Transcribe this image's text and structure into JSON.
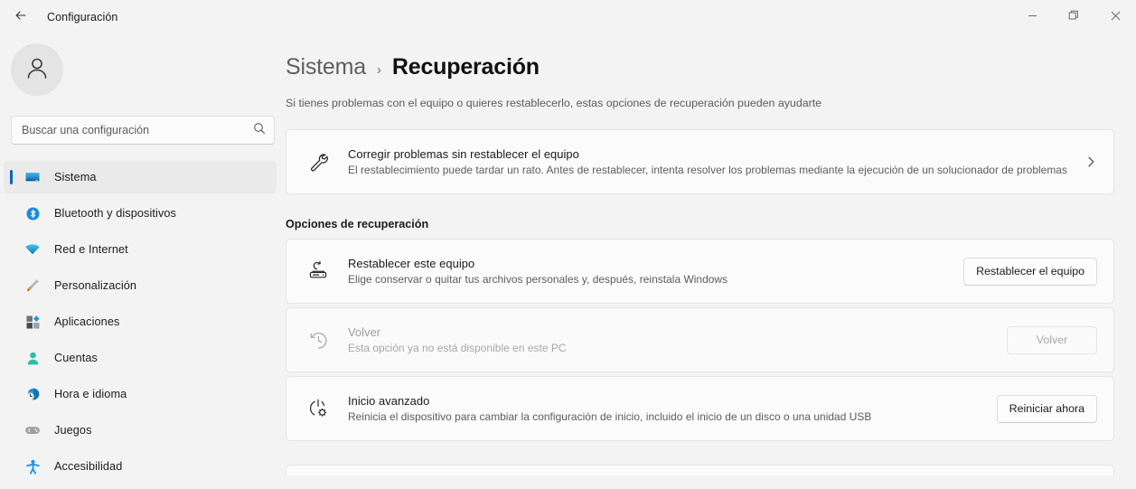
{
  "window": {
    "app_title": "Configuración",
    "back_icon": "back-arrow-icon",
    "minimize_label": "Minimizar",
    "maximize_label": "Maximizar",
    "close_label": "Cerrar"
  },
  "sidebar": {
    "avatar_icon": "user-avatar-icon",
    "search": {
      "placeholder": "Buscar una configuración",
      "value": "",
      "icon": "search-icon"
    },
    "items": [
      {
        "label": "Sistema",
        "icon": "monitor-icon",
        "active": true
      },
      {
        "label": "Bluetooth y dispositivos",
        "icon": "bluetooth-icon",
        "active": false
      },
      {
        "label": "Red e Internet",
        "icon": "wifi-icon",
        "active": false
      },
      {
        "label": "Personalización",
        "icon": "paintbrush-icon",
        "active": false
      },
      {
        "label": "Aplicaciones",
        "icon": "apps-icon",
        "active": false
      },
      {
        "label": "Cuentas",
        "icon": "person-icon",
        "active": false
      },
      {
        "label": "Hora e idioma",
        "icon": "clock-globe-icon",
        "active": false
      },
      {
        "label": "Juegos",
        "icon": "gamepad-icon",
        "active": false
      },
      {
        "label": "Accesibilidad",
        "icon": "accessibility-icon",
        "active": false
      }
    ]
  },
  "main": {
    "breadcrumb": {
      "parent": "Sistema",
      "separator": "›",
      "current": "Recuperación"
    },
    "description": "Si tienes problemas con el equipo o quieres restablecerlo, estas opciones de recuperación pueden ayudarte",
    "troubleshoot_card": {
      "icon": "wrench-icon",
      "title": "Corregir problemas sin restablecer el equipo",
      "subtitle": "El restablecimiento puede tardar un rato. Antes de restablecer, intenta resolver los problemas mediante la ejecución de un solucionador de problemas",
      "chevron": "chevron-right-icon"
    },
    "section_title": "Opciones de recuperación",
    "options": [
      {
        "icon": "reset-pc-icon",
        "title": "Restablecer este equipo",
        "subtitle": "Elige conservar o quitar tus archivos personales y, después, reinstala Windows",
        "button": "Restablecer el equipo",
        "disabled": false
      },
      {
        "icon": "history-clock-icon",
        "title": "Volver",
        "subtitle": "Esta opción ya no está disponible en este PC",
        "button": "Volver",
        "disabled": true
      },
      {
        "icon": "power-gear-icon",
        "title": "Inicio avanzado",
        "subtitle": "Reinicia el dispositivo para cambiar la configuración de inicio, incluido el inicio de un disco o una unidad USB",
        "button": "Reiniciar ahora",
        "disabled": false
      }
    ]
  },
  "colors": {
    "accent": "#0067c0",
    "background": "#f3f3f3",
    "card": "#fbfbfb",
    "border": "#e5e5e5",
    "text": "#1b1b1b",
    "text_secondary": "#5c5c5c",
    "text_disabled": "#a0a0a0"
  }
}
